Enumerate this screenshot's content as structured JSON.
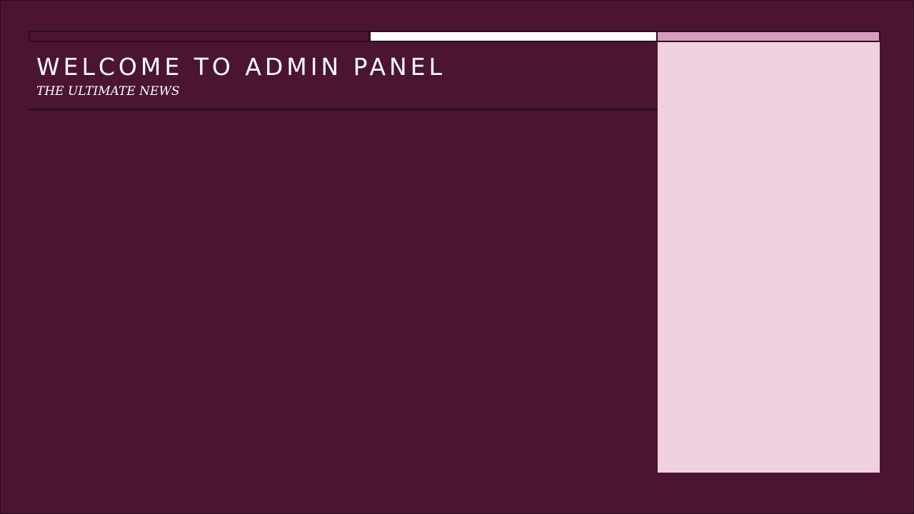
{
  "header": {
    "title": "WELCOME TO ADMIN PANEL",
    "subtitle": "THE ULTIMATE NEWS"
  },
  "colors": {
    "background": "#4b1532",
    "side_panel": "#efd1e0",
    "accent_pink": "#d79cbd",
    "accent_white": "#ffffff",
    "border_dark": "#2b0d1d"
  }
}
